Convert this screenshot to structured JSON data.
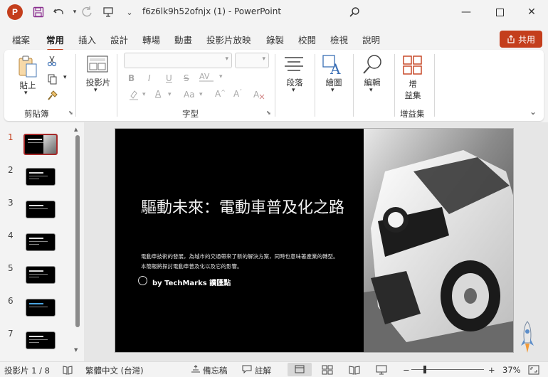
{
  "titlebar": {
    "logo_letter": "P",
    "title": "f6z6lk9h52ofnjx (1)  -  PowerPoint"
  },
  "tabs": [
    {
      "label": "檔案"
    },
    {
      "label": "常用",
      "active": true
    },
    {
      "label": "插入"
    },
    {
      "label": "設計"
    },
    {
      "label": "轉場"
    },
    {
      "label": "動畫"
    },
    {
      "label": "投影片放映"
    },
    {
      "label": "錄製"
    },
    {
      "label": "校閱"
    },
    {
      "label": "檢視"
    },
    {
      "label": "說明"
    }
  ],
  "share_label": "共用",
  "ribbon": {
    "paste_label": "貼上",
    "clipboard_group": "剪貼簿",
    "slides_label": "投影片",
    "font_group": "字型",
    "bold": "B",
    "italic": "I",
    "underline": "U",
    "strike": "S",
    "font_size_up": "A",
    "change_case": "Aa",
    "paragraph_label": "段落",
    "drawing_label": "繪圖",
    "editing_label": "編輯",
    "addins_label": "增\n益集",
    "addins_group": "增益集"
  },
  "slides": {
    "numbers": [
      "1",
      "2",
      "3",
      "4",
      "5",
      "6",
      "7"
    ],
    "active": 1
  },
  "slide": {
    "title": "驅動未來：電動車普及化之路",
    "body": "電動車技術的發展，為城市的交通帶來了新的解決方案，同時也意味著產業的轉型。本簡報將探討電動車普及化以及它的影響。",
    "byline": "by TechMarks 讀匯點"
  },
  "status": {
    "slide_info": "投影片 1 / 8",
    "language": "繁體中文 (台灣)",
    "notes": "備忘稿",
    "comments": "註解",
    "zoom": "37%"
  },
  "colors": {
    "accent": "#c43e1c",
    "slide_bg": "#000000"
  }
}
